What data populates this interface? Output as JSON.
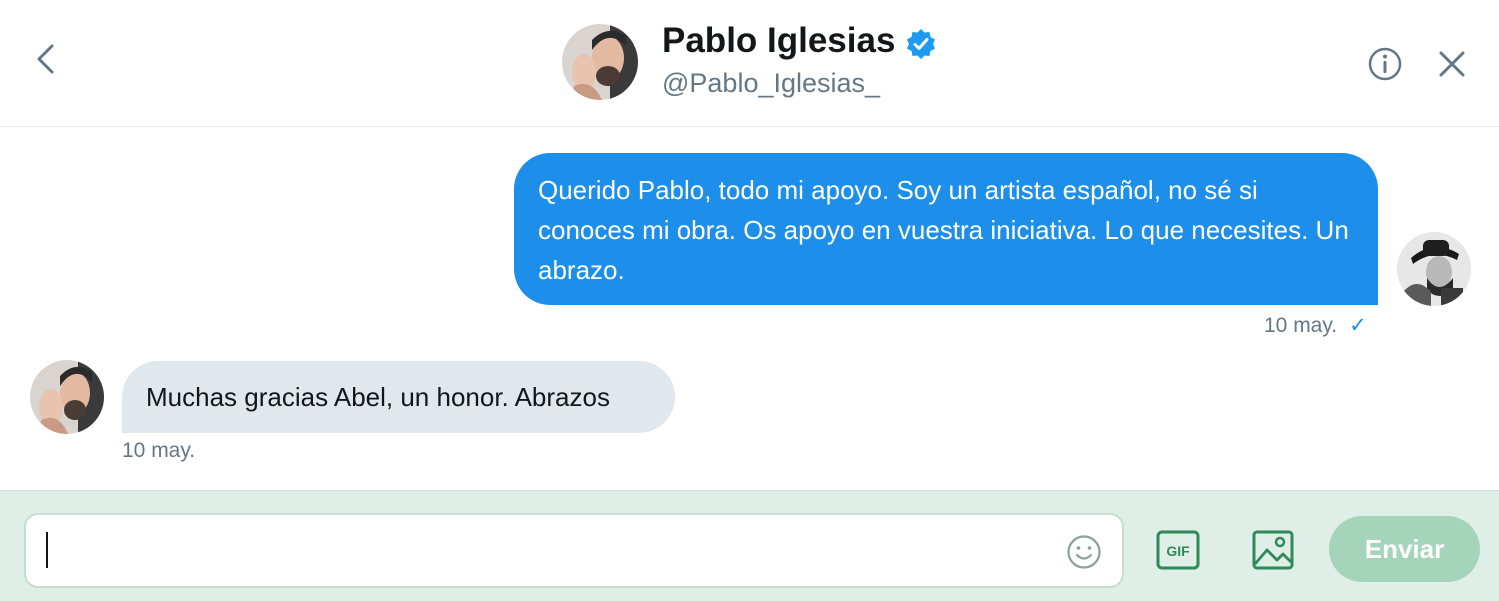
{
  "header": {
    "name": "Pablo Iglesias",
    "handle": "@Pablo_Iglesias_",
    "verified": true
  },
  "messages": [
    {
      "direction": "outgoing",
      "text": "Querido Pablo, todo mi apoyo. Soy un artista español, no sé si conoces mi obra. Os apoyo en vuestra iniciativa. Lo que necesites. Un abrazo.",
      "timestamp": "10 may.",
      "status_icon": "check-icon"
    },
    {
      "direction": "incoming",
      "text": "Muchas gracias Abel, un honor. Abrazos",
      "timestamp": "10 may."
    }
  ],
  "composer": {
    "placeholder": "",
    "value": "",
    "send_label": "Enviar",
    "gif_label": "GIF"
  },
  "colors": {
    "accent": "#1d8fea",
    "composer_bg": "#dfeee6",
    "send_disabled": "#a4d4b9",
    "icon_green": "#2e8b57",
    "incoming_bubble": "#e1e8ed"
  },
  "icons": [
    "back-arrow-icon",
    "verified-badge-icon",
    "info-icon",
    "close-icon",
    "emoji-icon",
    "gif-icon",
    "image-icon",
    "check-icon"
  ]
}
